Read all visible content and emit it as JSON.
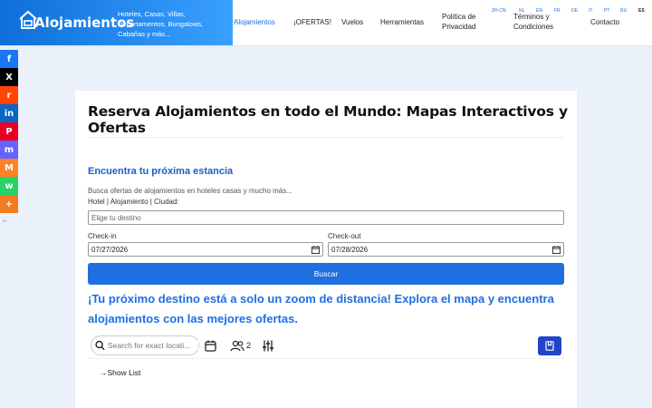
{
  "header": {
    "brand_name": "Alojamientos",
    "tagline": "Hoteles, Casas, Villas, Departamentos, Bungalows, Cabañas y más...",
    "brand_gradient": [
      "#0d6fd8",
      "#3aa0ff"
    ],
    "nav": [
      {
        "label": "Alojamientos",
        "active": true
      },
      {
        "label": "¡OFERTAS!",
        "active": false
      },
      {
        "label": "Vuelos",
        "active": false
      },
      {
        "label": "Herramientas",
        "active": false
      },
      {
        "label": "Política de Privacidad",
        "active": false
      },
      {
        "label": "Términos y Condiciones",
        "active": false
      },
      {
        "label": "Contacto",
        "active": false
      }
    ],
    "languages": [
      {
        "code": "ZH-CN",
        "active": false
      },
      {
        "code": "NL",
        "active": false
      },
      {
        "code": "EN",
        "active": false
      },
      {
        "code": "FR",
        "active": false
      },
      {
        "code": "DE",
        "active": false
      },
      {
        "code": "IT",
        "active": false
      },
      {
        "code": "PT",
        "active": false
      },
      {
        "code": "RU",
        "active": false
      },
      {
        "code": "ES",
        "active": true
      }
    ]
  },
  "social": [
    {
      "name": "facebook",
      "glyph": "f",
      "color": "#1877f2"
    },
    {
      "name": "x",
      "glyph": "X",
      "color": "#000000"
    },
    {
      "name": "reddit",
      "glyph": "r",
      "color": "#ff4500"
    },
    {
      "name": "linkedin",
      "glyph": "in",
      "color": "#0a66c2"
    },
    {
      "name": "pinterest",
      "glyph": "P",
      "color": "#e60023"
    },
    {
      "name": "mastodon",
      "glyph": "m",
      "color": "#6364ff"
    },
    {
      "name": "mix",
      "glyph": "M",
      "color": "#ff8226"
    },
    {
      "name": "whatsapp",
      "glyph": "w",
      "color": "#25d366"
    },
    {
      "name": "more",
      "glyph": "+",
      "color": "#f47b20"
    }
  ],
  "main": {
    "title": "Reserva Alojamientos en todo el Mundo: Mapas Interactivos y Ofertas",
    "widget": {
      "title": "Encuentra tu próxima estancia",
      "subtitle": "Busca ofertas de alojamientos en hoteles casas y mucho más...",
      "destination_label": "Hotel | Alojamiento | Ciudad:",
      "destination_placeholder": "Elige tu destino",
      "checkin_label": "Check-in",
      "checkin_value": "07/27/2026",
      "checkout_label": "Check-out",
      "checkout_value": "07/28/2026",
      "search_label": "Buscar"
    },
    "promo": "¡Tu próximo destino está a solo un zoom de distancia! Explora el mapa y encuentra alojamientos con las mejores ofertas.",
    "map_toolbar": {
      "search_placeholder": "Search for exact locati...",
      "guests": "2",
      "show_list": "Show List"
    }
  },
  "colors": {
    "accent": "#1f6fe0",
    "page_background": "#eaf1fb",
    "save_button": "#2144c8"
  }
}
